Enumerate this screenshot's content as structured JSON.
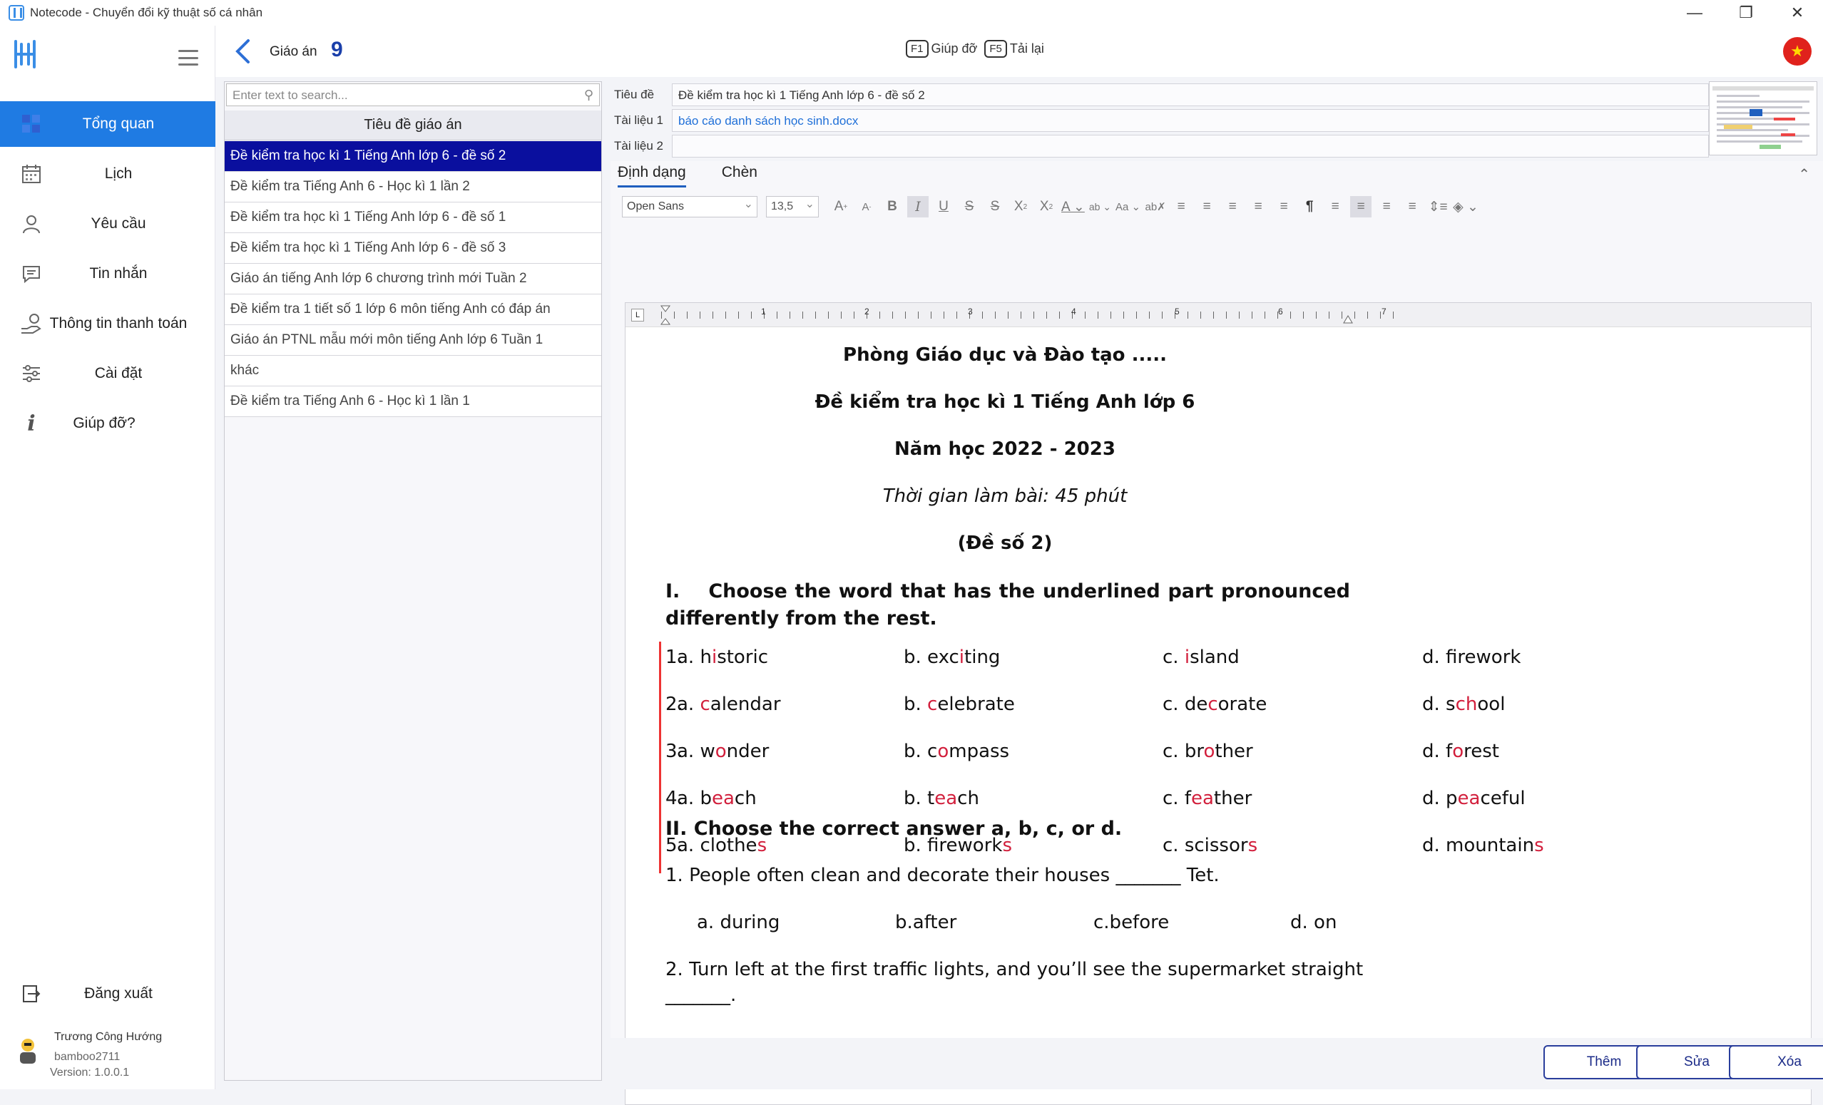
{
  "window": {
    "title": "Notecode - Chuyển đổi kỹ thuật số cá nhân"
  },
  "sidebar": {
    "items": [
      {
        "label": "Tổng quan",
        "icon": "dashboard-icon"
      },
      {
        "label": "Lịch",
        "icon": "calendar-icon"
      },
      {
        "label": "Yêu cầu",
        "icon": "user-icon"
      },
      {
        "label": "Tin nhắn",
        "icon": "chat-icon"
      },
      {
        "label": "Thông tin thanh toán",
        "icon": "payment-icon"
      },
      {
        "label": "Cài đặt",
        "icon": "sliders-icon"
      },
      {
        "label": "Giúp đỡ?",
        "icon": "info-icon"
      }
    ],
    "logout": "Đăng xuất",
    "user_name": "Trương Công Hướng",
    "username": "bamboo2711",
    "version": "Version: 1.0.0.1"
  },
  "header": {
    "label": "Giáo án",
    "count": "9",
    "help_key": "F1",
    "help_label": "Giúp đỡ",
    "reload_key": "F5",
    "reload_label": "Tải lại"
  },
  "list": {
    "search_placeholder": "Enter text to search...",
    "column_header": "Tiêu đề giáo án",
    "rows": [
      "Đề kiểm tra học kì 1 Tiếng Anh lớp 6 - đề số 2",
      "Đề kiểm tra Tiếng Anh 6 - Học kì 1 lần 2",
      "Đề kiểm tra học kì 1 Tiếng Anh lớp 6 - đề số 1",
      "Đề kiểm tra học kì 1 Tiếng Anh lớp 6 - đề số 3",
      "Giáo án tiếng Anh lớp 6 chương trình mới Tuần 2",
      "Đề kiểm tra 1 tiết số 1 lớp 6 môn tiếng Anh có đáp án",
      "Giáo án PTNL mẫu mới môn tiếng Anh lớp 6 Tuần 1",
      "khác",
      "Đề kiểm tra Tiếng Anh 6 - Học kì 1 lần 1"
    ]
  },
  "detail": {
    "title_label": "Tiêu đề",
    "title_value": "Đề kiểm tra học kì 1 Tiếng Anh lớp 6 - đề số 2",
    "doc1_label": "Tài liệu 1",
    "doc1_value": "báo cáo danh sách học sinh.docx",
    "doc2_label": "Tài liệu 2",
    "doc2_value": ""
  },
  "editor": {
    "tab_format": "Định dạng",
    "tab_insert": "Chèn",
    "font": "Open Sans",
    "size": "13,5",
    "ruler_numbers": [
      "1",
      "2",
      "3",
      "4",
      "5",
      "6",
      "7"
    ]
  },
  "document": {
    "line1": "Phòng Giáo dục và Đào tạo .....",
    "line2": "Đề kiểm tra học kì 1 Tiếng Anh lớp 6",
    "line3": "Năm học 2022 - 2023",
    "line4": "Thời gian làm bài: 45 phút",
    "line5": "(Đề số 2)",
    "q1_num": "I.",
    "q1_text": "Choose the word that has the underlined part pronounced differently from the rest.",
    "exercises": [
      {
        "n": "1.",
        "opts": [
          [
            "a. h",
            "i",
            "storic"
          ],
          [
            "b. exc",
            "i",
            "ting"
          ],
          [
            "c. ",
            "i",
            "sland"
          ],
          [
            "d. f",
            "i",
            "rework"
          ]
        ]
      },
      {
        "n": "2.",
        "opts": [
          [
            "a. ",
            "c",
            "alendar"
          ],
          [
            "b. ",
            "c",
            "elebrate"
          ],
          [
            "c. de",
            "c",
            "orate"
          ],
          [
            "d. s",
            "ch",
            "ool"
          ]
        ]
      },
      {
        "n": "3.",
        "opts": [
          [
            "a. w",
            "o",
            "nder"
          ],
          [
            "b. c",
            "o",
            "mpass"
          ],
          [
            "c. br",
            "o",
            "ther"
          ],
          [
            "d. f",
            "o",
            "rest"
          ]
        ]
      },
      {
        "n": "4.",
        "opts": [
          [
            "a. b",
            "ea",
            "ch"
          ],
          [
            "b. t",
            "ea",
            "ch"
          ],
          [
            "c. f",
            "ea",
            "ther"
          ],
          [
            "d. p",
            "ea",
            "ceful"
          ]
        ]
      },
      {
        "n": "5.",
        "opts": [
          [
            "a. clothe",
            "s",
            ""
          ],
          [
            "b. firework",
            "s",
            ""
          ],
          [
            "c. scissor",
            "s",
            ""
          ],
          [
            "d. mountain",
            "s",
            ""
          ]
        ]
      }
    ],
    "q2": "II.  Choose the correct answer a, b, c, or d.",
    "q2_1": "1.   People often clean and decorate their houses _______ Tet.",
    "q2_1_opts": [
      "a. during",
      "b.after",
      "c.before",
      "d. on"
    ],
    "q2_2": "2.   Turn left at the first traffic lights, and you’ll see the supermarket straight",
    "q2_2_cont": "_______."
  },
  "buttons": {
    "add": "Thêm",
    "edit": "Sửa",
    "delete": "Xóa"
  }
}
